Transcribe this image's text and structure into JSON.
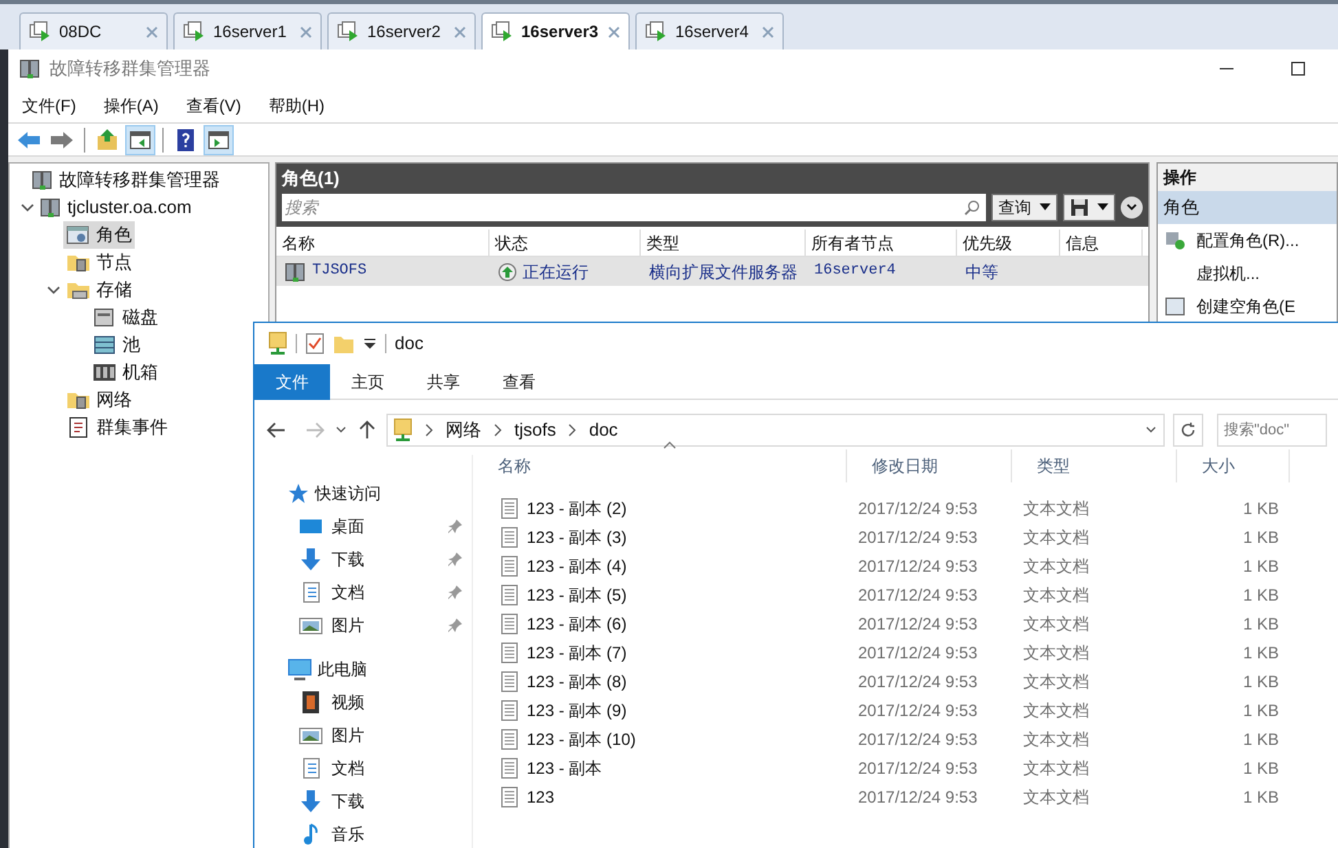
{
  "tabs": [
    {
      "label": "08DC",
      "selected": false
    },
    {
      "label": "16server1",
      "selected": false
    },
    {
      "label": "16server2",
      "selected": false
    },
    {
      "label": "16server3",
      "selected": true
    },
    {
      "label": "16server4",
      "selected": false
    }
  ],
  "window": {
    "title": "故障转移群集管理器"
  },
  "menu": [
    "文件(F)",
    "操作(A)",
    "查看(V)",
    "帮助(H)"
  ],
  "toolbar": [
    {
      "kind": "back",
      "pressed": false
    },
    {
      "kind": "forward",
      "pressed": false
    },
    {
      "kind": "up",
      "pressed": false
    },
    {
      "kind": "console-tree",
      "pressed": true
    },
    {
      "kind": "help",
      "pressed": false
    },
    {
      "kind": "action-pane",
      "pressed": true
    }
  ],
  "tree": [
    {
      "label": "故障转移群集管理器",
      "selected": false
    },
    {
      "label": "tjcluster.oa.com",
      "selected": false,
      "expanded": true,
      "children": [
        {
          "label": "角色",
          "selected": true
        },
        {
          "label": "节点",
          "selected": false
        },
        {
          "label": "存储",
          "selected": false,
          "expanded": true,
          "children": [
            {
              "label": "磁盘",
              "selected": false
            },
            {
              "label": "池",
              "selected": false
            },
            {
              "label": "机箱",
              "selected": false
            }
          ]
        },
        {
          "label": "网络",
          "selected": false
        },
        {
          "label": "群集事件",
          "selected": false
        }
      ]
    }
  ],
  "roles_panel": {
    "title": "角色(1)",
    "search_placeholder": "搜索",
    "query_button": "查询",
    "columns": [
      "名称",
      "状态",
      "类型",
      "所有者节点",
      "优先级",
      "信息"
    ],
    "rows": [
      {
        "name": "TJSOFS",
        "status": "正在运行",
        "type": "横向扩展文件服务器",
        "owner": "16server4",
        "priority": "中等",
        "selected": true
      }
    ]
  },
  "actions": {
    "title": "操作",
    "section": "角色",
    "items": [
      "配置角色(R)...",
      "虚拟机...",
      "创建空角色(E"
    ]
  },
  "explorer": {
    "title": "doc",
    "ribbon_tabs": [
      {
        "label": "文件",
        "selected": true
      },
      {
        "label": "主页",
        "selected": false
      },
      {
        "label": "共享",
        "selected": false
      },
      {
        "label": "查看",
        "selected": false
      }
    ],
    "path": [
      "网络",
      "tjsofs",
      "doc"
    ],
    "search_placeholder": "搜索\"doc\"",
    "columns": [
      "名称",
      "修改日期",
      "类型",
      "大小"
    ],
    "nav": [
      {
        "label": "快速访问",
        "children": [
          {
            "label": "桌面",
            "pinned": true
          },
          {
            "label": "下载",
            "pinned": true
          },
          {
            "label": "文档",
            "pinned": true
          },
          {
            "label": "图片",
            "pinned": true
          }
        ]
      },
      {
        "label": "此电脑",
        "children": [
          {
            "label": "视频",
            "pinned": false
          },
          {
            "label": "图片",
            "pinned": false
          },
          {
            "label": "文档",
            "pinned": false
          },
          {
            "label": "下载",
            "pinned": false
          },
          {
            "label": "音乐",
            "pinned": false
          }
        ]
      }
    ],
    "files": [
      {
        "name": "123 - 副本 (2)",
        "date": "2017/12/24 9:53",
        "type": "文本文档",
        "size": "1 KB"
      },
      {
        "name": "123 - 副本 (3)",
        "date": "2017/12/24 9:53",
        "type": "文本文档",
        "size": "1 KB"
      },
      {
        "name": "123 - 副本 (4)",
        "date": "2017/12/24 9:53",
        "type": "文本文档",
        "size": "1 KB"
      },
      {
        "name": "123 - 副本 (5)",
        "date": "2017/12/24 9:53",
        "type": "文本文档",
        "size": "1 KB"
      },
      {
        "name": "123 - 副本 (6)",
        "date": "2017/12/24 9:53",
        "type": "文本文档",
        "size": "1 KB"
      },
      {
        "name": "123 - 副本 (7)",
        "date": "2017/12/24 9:53",
        "type": "文本文档",
        "size": "1 KB"
      },
      {
        "name": "123 - 副本 (8)",
        "date": "2017/12/24 9:53",
        "type": "文本文档",
        "size": "1 KB"
      },
      {
        "name": "123 - 副本 (9)",
        "date": "2017/12/24 9:53",
        "type": "文本文档",
        "size": "1 KB"
      },
      {
        "name": "123 - 副本 (10)",
        "date": "2017/12/24 9:53",
        "type": "文本文档",
        "size": "1 KB"
      },
      {
        "name": "123 - 副本",
        "date": "2017/12/24 9:53",
        "type": "文本文档",
        "size": "1 KB"
      },
      {
        "name": "123",
        "date": "2017/12/24 9:53",
        "type": "文本文档",
        "size": "1 KB"
      }
    ]
  }
}
